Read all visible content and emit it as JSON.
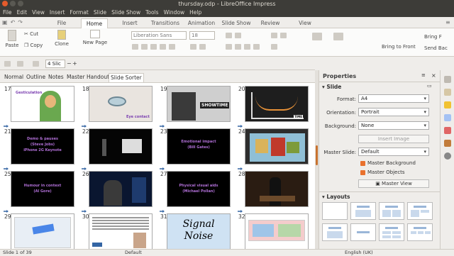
{
  "window": {
    "title": "thursday.odp - LibreOffice Impress"
  },
  "menu": [
    "File",
    "Edit",
    "View",
    "Insert",
    "Format",
    "Slide",
    "Slide Show",
    "Tools",
    "Window",
    "Help"
  ],
  "ribbon_tabs": [
    "File",
    "Home",
    "Insert",
    "Transitions",
    "Animation",
    "Slide Show",
    "Review",
    "View"
  ],
  "active_ribbon_tab": "Home",
  "ribbon": {
    "paste": "Paste",
    "cut": "Cut",
    "copy": "Copy",
    "clone": "Clone",
    "new_page": "New Page",
    "font_name": "Liberation Sans",
    "font_size": "18",
    "bring_to_front": "Bring to Front",
    "bring_front_short": "Bring F",
    "send_back": "Send Bac"
  },
  "toolbar2": {
    "slides_per_row": "4 Slic",
    "minus": "−",
    "plus": "+"
  },
  "view_tabs": [
    "Normal",
    "Outline",
    "Notes",
    "Master Handout",
    "Slide Sorter"
  ],
  "active_view_tab": "Slide Sorter",
  "slides": [
    {
      "n": "17",
      "text": "Gesticulation"
    },
    {
      "n": "18",
      "text": "Eye contact"
    },
    {
      "n": "19",
      "text": "SHOWTIME"
    },
    {
      "n": "20",
      "text": "TIME"
    },
    {
      "n": "21",
      "text": "Demo & pauses\n(Steve Jobs)\niPhone 2G Keynote"
    },
    {
      "n": "22",
      "text": ""
    },
    {
      "n": "23",
      "text": "Emotional impact\n(Bill Gates)"
    },
    {
      "n": "24",
      "text": ""
    },
    {
      "n": "25",
      "text": "Humour in context\n(Al Gore)"
    },
    {
      "n": "26",
      "text": ""
    },
    {
      "n": "27",
      "text": "Physical visual aids\n(Michael Pollan)"
    },
    {
      "n": "28",
      "text": ""
    },
    {
      "n": "29",
      "text": ""
    },
    {
      "n": "30",
      "text": ""
    },
    {
      "n": "31",
      "text": "Signal\nNoise"
    },
    {
      "n": "32",
      "text": ""
    }
  ],
  "properties": {
    "title": "Properties",
    "section_slide": "Slide",
    "format_label": "Format:",
    "format_value": "A4",
    "orientation_label": "Orientation:",
    "orientation_value": "Portrait",
    "background_label": "Background:",
    "background_value": "None",
    "insert_image": "Insert Image",
    "master_slide_label": "Master Slide:",
    "master_slide_value": "Default",
    "master_background": "Master Background",
    "master_objects": "Master Objects",
    "master_view": "Master View",
    "section_layouts": "Layouts"
  },
  "status": {
    "slide": "Slide 1 of 39",
    "master": "Default",
    "lang": "English (UK)"
  },
  "colors": {
    "accent": "#e9712d",
    "titlebar": "#3d3c38",
    "slide_purple": "#b06fd6"
  }
}
